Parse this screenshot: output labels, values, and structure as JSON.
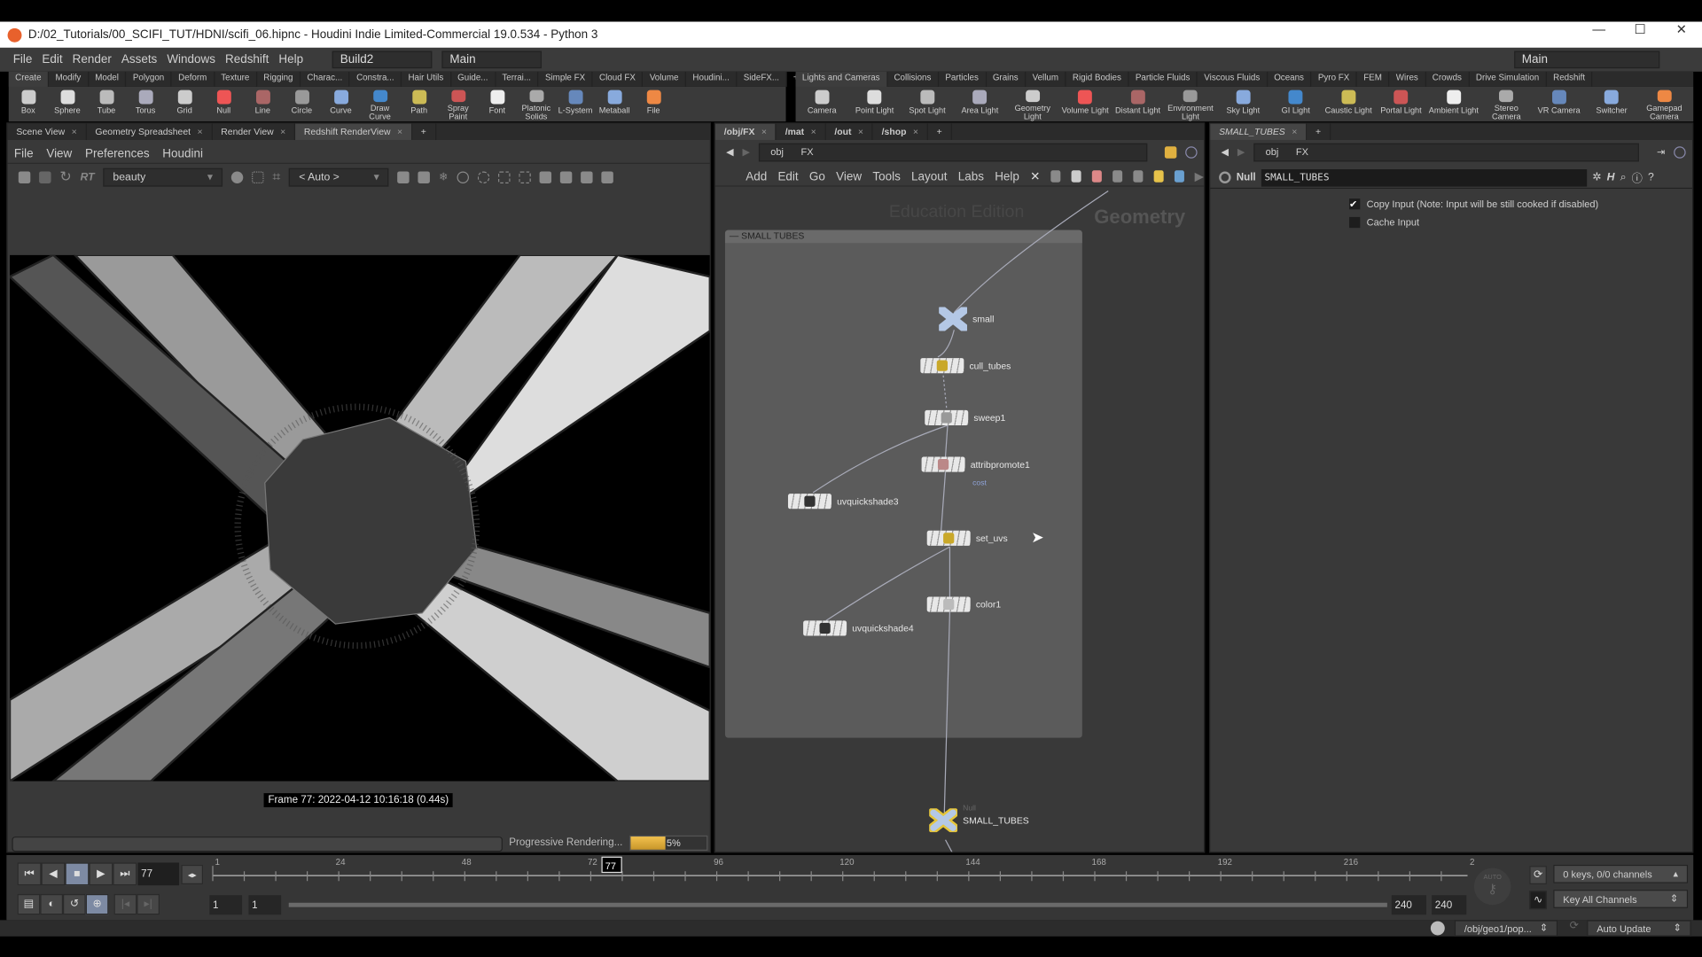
{
  "window": {
    "title": "D:/02_Tutorials/00_SCIFI_TUT/HDNI/scifi_06.hipnc - Houdini Indie Limited-Commercial 19.0.534 - Python 3",
    "controls": [
      "—",
      "☐",
      "✕"
    ]
  },
  "menubar": {
    "items": [
      "File",
      "Edit",
      "Render",
      "Assets",
      "Windows",
      "Redshift",
      "Help"
    ],
    "desktop": "Build2",
    "context": "Main",
    "right_desktop": "Main"
  },
  "shelf_left": {
    "tabs": [
      "Create",
      "Modify",
      "Model",
      "Polygon",
      "Deform",
      "Texture",
      "Rigging",
      "Charac...",
      "Constra...",
      "Hair Utils",
      "Guide...",
      "Terrai...",
      "Simple FX",
      "Cloud FX",
      "Volume",
      "Houdini...",
      "SideFX..."
    ],
    "tools": [
      "Box",
      "Sphere",
      "Tube",
      "Torus",
      "Grid",
      "Null",
      "Line",
      "Circle",
      "Curve",
      "Draw Curve",
      "Path",
      "Spray Paint",
      "Font",
      "Platonic Solids",
      "L-System",
      "Metaball",
      "File"
    ]
  },
  "shelf_right": {
    "tabs": [
      "Lights and Cameras",
      "Collisions",
      "Particles",
      "Grains",
      "Vellum",
      "Rigid Bodies",
      "Particle Fluids",
      "Viscous Fluids",
      "Oceans",
      "Pyro FX",
      "FEM",
      "Wires",
      "Crowds",
      "Drive Simulation",
      "Redshift"
    ],
    "tools": [
      "Camera",
      "Point Light",
      "Spot Light",
      "Area Light",
      "Geometry Light",
      "Volume Light",
      "Distant Light",
      "Environment Light",
      "Sky Light",
      "GI Light",
      "Caustic Light",
      "Portal Light",
      "Ambient Light",
      "Stereo Camera",
      "VR Camera",
      "Switcher",
      "Gamepad Camera"
    ]
  },
  "left_pane": {
    "tabs": [
      "Scene View",
      "Geometry Spreadsheet",
      "Render View",
      "Redshift RenderView"
    ],
    "menu": [
      "File",
      "View",
      "Preferences",
      "Houdini"
    ],
    "rt_label": "RT",
    "aov": "beauty",
    "camera": "< Auto >",
    "frame_info": "Frame 77: 2022-04-12 10:16:18 (0.44s)",
    "progress_label": "Progressive Rendering...",
    "progress_text": "5%",
    "progress": 0.45
  },
  "network": {
    "tabs": [
      "/obj/FX",
      "/mat",
      "/out",
      "/shop"
    ],
    "path": [
      "obj",
      "FX"
    ],
    "menu": [
      "Add",
      "Edit",
      "Go",
      "View",
      "Tools",
      "Layout",
      "Labs",
      "Help"
    ],
    "watermark": "Education Edition",
    "context_label": "Geometry",
    "netbox_title": "SMALL TUBES",
    "nodes": [
      {
        "name": "small"
      },
      {
        "name": "cull_tubes"
      },
      {
        "name": "sweep1"
      },
      {
        "name": "attribpromote1",
        "badge": "cost"
      },
      {
        "name": "uvquickshade3"
      },
      {
        "name": "set_uvs"
      },
      {
        "name": "color1"
      },
      {
        "name": "uvquickshade4"
      },
      {
        "name": "SMALL_TUBES",
        "type": "Null"
      }
    ]
  },
  "params": {
    "tab": "SMALL_TUBES",
    "path": [
      "obj",
      "FX"
    ],
    "node_type": "Null",
    "node_name": "SMALL_TUBES",
    "copy_input": {
      "label": "Copy Input (Note: Input will be still cooked if disabled)",
      "checked": true
    },
    "cache_input": {
      "label": "Cache Input",
      "checked": false
    }
  },
  "timeline": {
    "current_frame": "77",
    "ticks": [
      "1",
      "24",
      "48",
      "72",
      "96",
      "120",
      "144",
      "168",
      "192",
      "216",
      "2"
    ],
    "start": "1",
    "start2": "1",
    "end": "240",
    "end2": "240",
    "keys_info": "0 keys, 0/0 channels",
    "key_mode": "Key All Channels",
    "auto_label": "AUTO"
  },
  "status": {
    "path": "/obj/geo1/pop...",
    "update_mode": "Auto Update"
  },
  "colors": {
    "accent_yellow": "#e8b93a",
    "netbox": "#5b5b5b",
    "bg": "#393939"
  }
}
